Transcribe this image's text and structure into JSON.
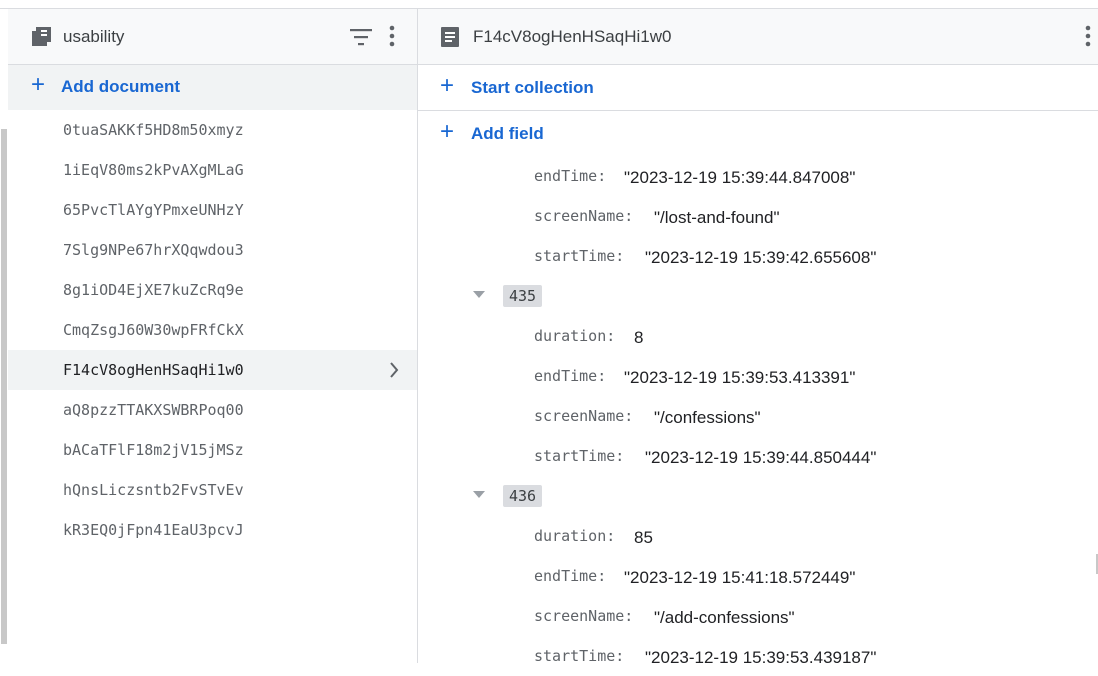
{
  "left": {
    "collection_title": "usability",
    "add_document_label": "Add document",
    "documents": [
      "0tuaSAKKf5HD8m50xmyz",
      "1iEqV80ms2kPvAXgMLaG",
      "65PvcTlAYgYPmxeUNHzY",
      "7Slg9NPe67hrXQqwdou3",
      "8g1iOD4EjXE7kuZcRq9e",
      "CmqZsgJ60W30wpFRfCkX",
      "F14cV8ogHenHSaqHi1w0",
      "aQ8pzzTTAKXSWBRPoq00",
      "bACaTFlF18m2jV15jMSz",
      "hQnsLiczsntb2FvSTvEv",
      "kR3EQ0jFpn41EaU3pcvJ"
    ],
    "selected_index": 6
  },
  "right": {
    "document_title": "F14cV8ogHenHSaqHi1w0",
    "start_collection_label": "Start collection",
    "add_field_label": "Add field",
    "rows": [
      {
        "type": "field",
        "key": "endTime:",
        "value": "\"2023-12-19 15:39:44.847008\""
      },
      {
        "type": "field",
        "key": "screenName:",
        "value": "\"/lost-and-found\""
      },
      {
        "type": "field",
        "key": "startTime:",
        "value": "\"2023-12-19 15:39:42.655608\""
      },
      {
        "type": "group",
        "index": "435"
      },
      {
        "type": "field",
        "key": "duration:",
        "value": "8"
      },
      {
        "type": "field",
        "key": "endTime:",
        "value": "\"2023-12-19 15:39:53.413391\""
      },
      {
        "type": "field",
        "key": "screenName:",
        "value": "\"/confessions\""
      },
      {
        "type": "field",
        "key": "startTime:",
        "value": "\"2023-12-19 15:39:44.850444\""
      },
      {
        "type": "group",
        "index": "436"
      },
      {
        "type": "field",
        "key": "duration:",
        "value": "85"
      },
      {
        "type": "field",
        "key": "endTime:",
        "value": "\"2023-12-19 15:41:18.572449\""
      },
      {
        "type": "field",
        "key": "screenName:",
        "value": "\"/add-confessions\""
      },
      {
        "type": "field",
        "key": "startTime:",
        "value": "\"2023-12-19 15:39:53.439187\""
      }
    ]
  },
  "colors": {
    "accent": "#1967d2",
    "selected_bg": "#f1f3f4",
    "badge_bg": "#dadce0"
  },
  "icons": {
    "collection": "collection-icon",
    "filter": "filter-icon",
    "more": "more-vert-icon",
    "document": "document-icon",
    "chevron": "chevron-right-icon",
    "expand": "expand-triangle-icon"
  }
}
